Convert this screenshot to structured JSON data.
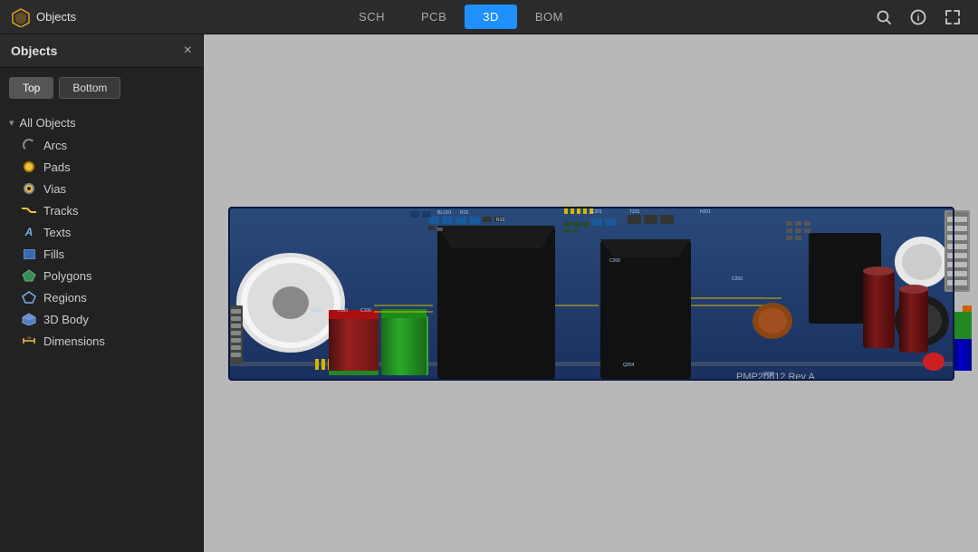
{
  "app": {
    "logo_text": "Objects",
    "logo_icon": "⬡"
  },
  "topbar": {
    "tabs": [
      {
        "id": "sch",
        "label": "SCH",
        "active": false
      },
      {
        "id": "pcb",
        "label": "PCB",
        "active": false
      },
      {
        "id": "3d",
        "label": "3D",
        "active": true
      },
      {
        "id": "bom",
        "label": "BOM",
        "active": false
      }
    ],
    "search_icon": "🔍",
    "info_icon": "ℹ",
    "expand_icon": "⤢"
  },
  "sidebar": {
    "title": "Objects",
    "close_label": "×",
    "view_buttons": [
      {
        "id": "top",
        "label": "Top",
        "active": true
      },
      {
        "id": "bottom",
        "label": "Bottom",
        "active": false
      }
    ],
    "all_objects_label": "All Objects",
    "items": [
      {
        "id": "arcs",
        "label": "Arcs",
        "icon_type": "arc"
      },
      {
        "id": "pads",
        "label": "Pads",
        "icon_type": "pad"
      },
      {
        "id": "vias",
        "label": "Vias",
        "icon_type": "via"
      },
      {
        "id": "tracks",
        "label": "Tracks",
        "icon_type": "track"
      },
      {
        "id": "texts",
        "label": "Texts",
        "icon_type": "text"
      },
      {
        "id": "fills",
        "label": "Fills",
        "icon_type": "fill"
      },
      {
        "id": "polygons",
        "label": "Polygons",
        "icon_type": "polygon"
      },
      {
        "id": "regions",
        "label": "Regions",
        "icon_type": "region"
      },
      {
        "id": "3dbody",
        "label": "3D Body",
        "icon_type": "3dbody"
      },
      {
        "id": "dimensions",
        "label": "Dimensions",
        "icon_type": "dimensions"
      }
    ]
  },
  "pcb": {
    "label": "PMP20612 Rev A"
  }
}
